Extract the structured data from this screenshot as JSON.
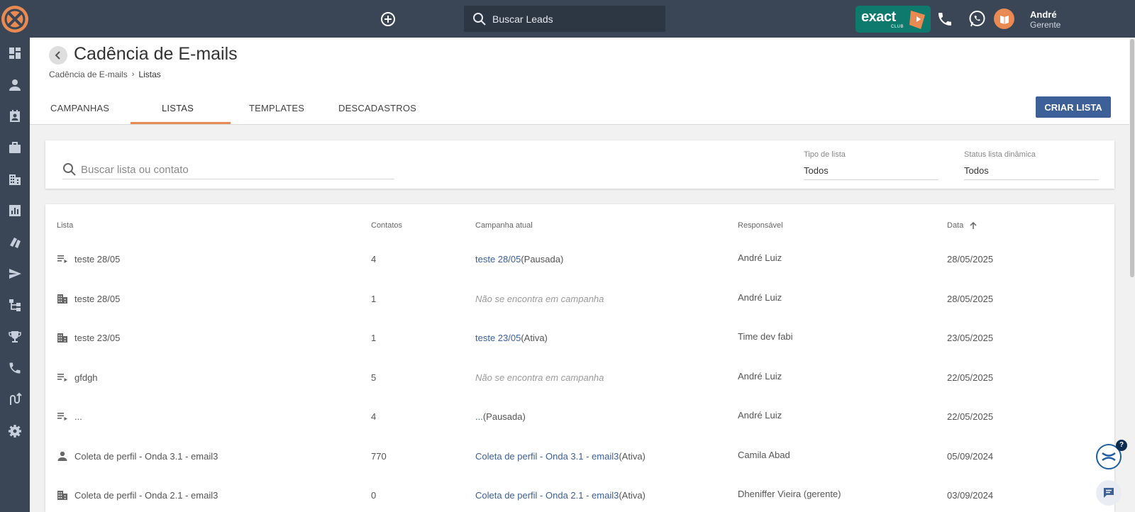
{
  "topbar": {
    "search_placeholder": "Buscar Leads",
    "brand": {
      "name": "exact",
      "sub": "CLUB"
    },
    "user": {
      "name": "André",
      "role": "Gerente"
    }
  },
  "colors": {
    "topbar": "#3a4556",
    "accent_orange": "#e98a52",
    "primary_blue": "#3d6098",
    "brand_teal": "#0e7a6e"
  },
  "sidebar": {
    "items": [
      {
        "icon": "dashboard-icon"
      },
      {
        "icon": "person-icon"
      },
      {
        "icon": "contact-card-icon"
      },
      {
        "icon": "briefcase-icon"
      },
      {
        "icon": "building-icon"
      },
      {
        "icon": "bar-chart-icon"
      },
      {
        "icon": "cards-icon"
      },
      {
        "icon": "send-icon"
      },
      {
        "icon": "hierarchy-icon"
      },
      {
        "icon": "trophy-icon"
      },
      {
        "icon": "phone-icon"
      },
      {
        "icon": "route-icon"
      },
      {
        "icon": "gear-icon"
      }
    ]
  },
  "header": {
    "title": "Cadência de E-mails",
    "breadcrumb": {
      "parent": "Cadência de E-mails",
      "current": "Listas"
    },
    "tabs": [
      {
        "label": "CAMPANHAS"
      },
      {
        "label": "LISTAS"
      },
      {
        "label": "TEMPLATES"
      },
      {
        "label": "DESCADASTROS"
      }
    ],
    "active_tab": "LISTAS",
    "create_button": "CRIAR LISTA"
  },
  "filters": {
    "search_placeholder": "Buscar lista ou contato",
    "tipo_lista": {
      "label": "Tipo de lista",
      "value": "Todos"
    },
    "status_dinamica": {
      "label": "Status lista dinâmica",
      "value": "Todos"
    }
  },
  "table": {
    "columns": {
      "lista": "Lista",
      "contatos": "Contatos",
      "campanha": "Campanha atual",
      "responsavel": "Responsável",
      "data": "Data"
    },
    "sort": {
      "column": "Data",
      "direction": "asc"
    },
    "rows": [
      {
        "type": "static-list-icon",
        "lista": "teste 28/05",
        "contatos": "4",
        "campanha": "teste 28/05",
        "status": "(Pausada)",
        "responsavel": "André Luiz",
        "data": "28/05/2025"
      },
      {
        "type": "company-icon",
        "lista": "teste 28/05",
        "contatos": "1",
        "campanha": "",
        "none_text": "Não se encontra em campanha",
        "status": "",
        "responsavel": "André Luiz",
        "data": "28/05/2025"
      },
      {
        "type": "company-icon",
        "lista": "teste 23/05",
        "contatos": "1",
        "campanha": "teste 23/05",
        "status": "(Ativa)",
        "responsavel": "Time dev fabi",
        "data": "23/05/2025"
      },
      {
        "type": "static-list-icon",
        "lista": "gfdgh",
        "contatos": "5",
        "campanha": "",
        "none_text": "Não se encontra em campanha",
        "status": "",
        "responsavel": "André Luiz",
        "data": "22/05/2025"
      },
      {
        "type": "static-list-icon",
        "lista": "...",
        "contatos": "4",
        "campanha": "...",
        "status": "(Pausada)",
        "responsavel": "André Luiz",
        "data": "22/05/2025"
      },
      {
        "type": "person-icon",
        "lista": "Coleta de perfil - Onda 3.1 - email3",
        "contatos": "770",
        "campanha": "Coleta de perfil - Onda 3.1 - email3",
        "status": "(Ativa)",
        "responsavel": "Camila Abad",
        "data": "05/09/2024"
      },
      {
        "type": "company-icon",
        "lista": "Coleta de perfil - Onda 2.1 - email3",
        "contatos": "0",
        "campanha": "Coleta de perfil - Onda 2.1 - email3",
        "status": "(Ativa)",
        "responsavel": "Dheniffer Vieira (gerente)",
        "data": "03/09/2024"
      }
    ]
  },
  "widgets": {
    "help_badge": "?"
  }
}
